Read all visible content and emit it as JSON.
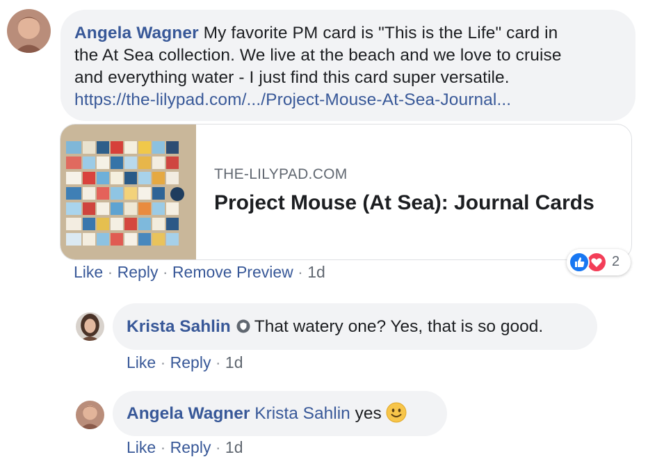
{
  "comment": {
    "author": "Angela Wagner",
    "text_lines": [
      "My favorite PM card is \"This is the Life\" card in",
      "the At Sea collection. We live at the beach and we love to cruise",
      "and everything water - I just find this card super versatile."
    ],
    "link": "https://the-lilypad.com/.../Project-Mouse-At-Sea-Journal...",
    "preview": {
      "domain": "THE-LILYPAD.COM",
      "title": "Project Mouse (At Sea): Journal Cards"
    },
    "actions": {
      "like": "Like",
      "reply": "Reply",
      "remove_preview": "Remove Preview",
      "time": "1d"
    },
    "reactions": {
      "count": "2",
      "types": [
        "like-icon",
        "love-icon"
      ]
    }
  },
  "replies": [
    {
      "author": "Krista Sahlin",
      "text": "That watery one? Yes, that is so good.",
      "actions": {
        "like": "Like",
        "reply": "Reply",
        "time": "1d"
      }
    },
    {
      "author": "Angela Wagner",
      "mention": "Krista Sahlin",
      "text": "yes",
      "emoji": "slightly-smiling-face-emoji",
      "actions": {
        "like": "Like",
        "reply": "Reply",
        "time": "1d"
      }
    }
  ],
  "colors": {
    "link": "#385898",
    "bubble": "#f2f3f5",
    "meta": "#606770",
    "like_blue": "#1877f2",
    "love_red": "#f33e58"
  }
}
